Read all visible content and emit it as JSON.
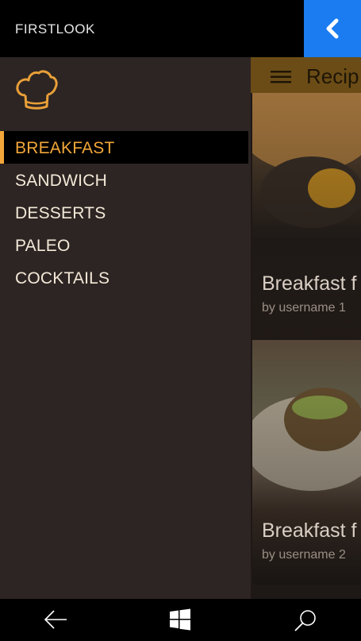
{
  "header": {
    "app_title": "FIRSTLOOK",
    "back_icon": "chevron-left-icon"
  },
  "drawer": {
    "logo_icon": "chef-hat-icon",
    "items": [
      {
        "label": "BREAKFAST",
        "active": true
      },
      {
        "label": "SANDWICH",
        "active": false
      },
      {
        "label": "DESSERTS",
        "active": false
      },
      {
        "label": "PALEO",
        "active": false
      },
      {
        "label": "COCKTAILS",
        "active": false
      }
    ]
  },
  "content": {
    "title": "Recip",
    "menu_icon": "hamburger-icon",
    "cards": [
      {
        "title": "Breakfast f",
        "author": "by username 1"
      },
      {
        "title": "Breakfast f",
        "author": "by username 2"
      }
    ]
  },
  "system_bar": {
    "icons": [
      "back-arrow-icon",
      "windows-icon",
      "search-icon"
    ]
  },
  "colors": {
    "accent": "#f3a73a",
    "back_button": "#1a7cf0",
    "drawer_bg": "#2d2523"
  }
}
